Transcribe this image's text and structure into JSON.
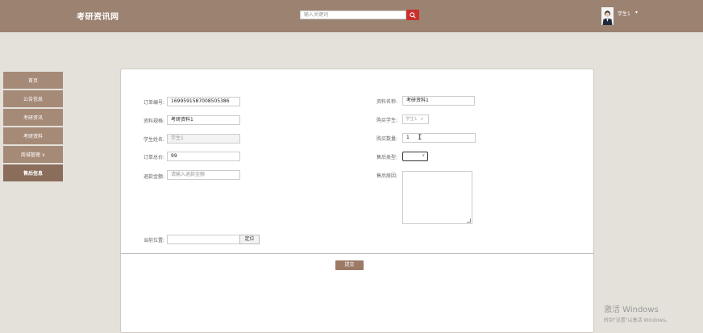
{
  "header": {
    "logo": "考研资讯网",
    "search_placeholder": "输入关键词",
    "search_icon": "search-icon",
    "user": {
      "name": "学生1",
      "caret": "▾"
    }
  },
  "sidebar": {
    "items": [
      {
        "label": "首页"
      },
      {
        "label": "公告信息"
      },
      {
        "label": "考研资讯"
      },
      {
        "label": "考研资料"
      },
      {
        "label": "商城管理 ∨"
      },
      {
        "label": "售后信息"
      }
    ]
  },
  "form": {
    "order_no_label": "订单编号:",
    "order_no": "1699591587008505386",
    "material_name_label": "资料名称:",
    "material_name": "考研资料1",
    "material_spec_label": "资料规格:",
    "material_spec": "考研资料1",
    "buyer_label": "购买学生:",
    "buyer_value": "学生1",
    "student_name_label": "学生姓名:",
    "student_name": "学生1",
    "quantity_label": "购买数量:",
    "quantity": "1",
    "total_price_label": "订单总价:",
    "total_price": "99",
    "aftersale_type_label": "售后类型:",
    "refund_label": "退款金额:",
    "refund_placeholder": "请输入退款金额",
    "reason_label": "售后原因:",
    "location_label": "当前位置:",
    "locate_button": "定位",
    "submit_button": "提交"
  },
  "watermark": {
    "line1": "激活 Windows",
    "line2": "转到\"设置\"以激活 Windows。"
  }
}
